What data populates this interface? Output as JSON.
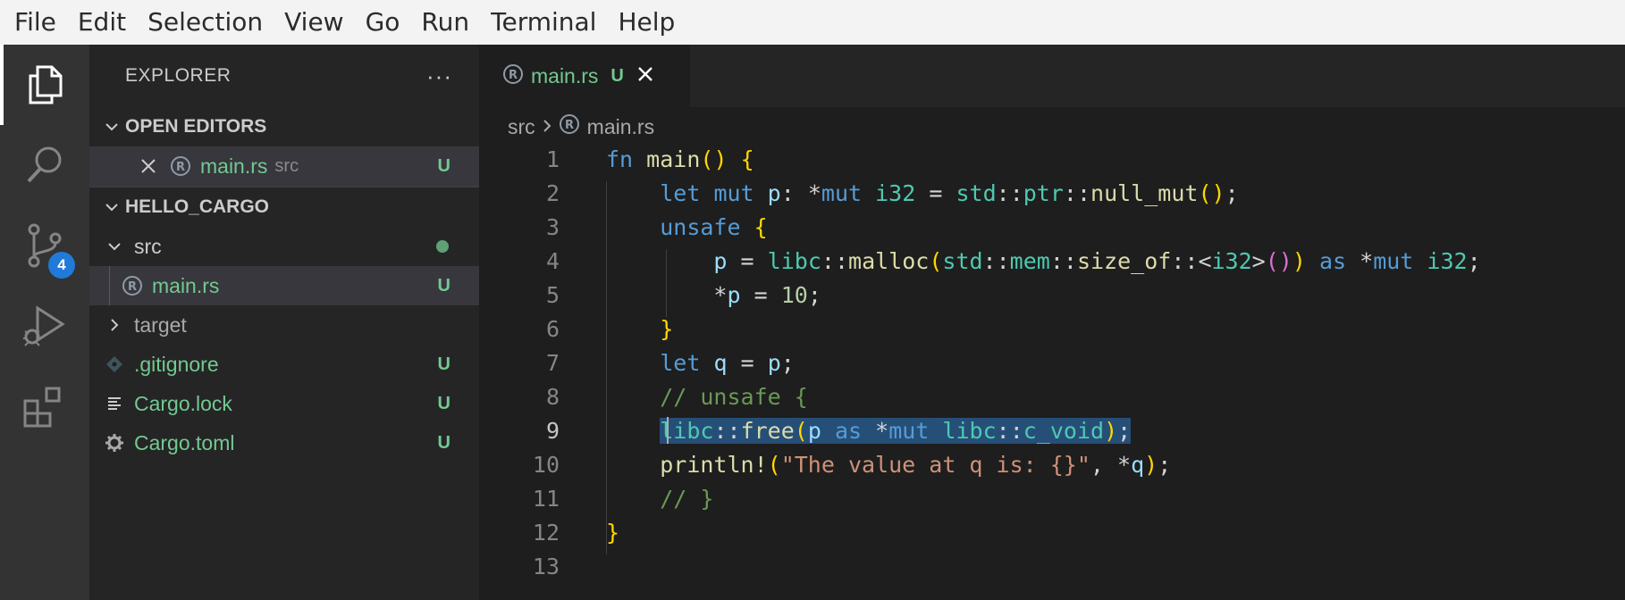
{
  "menu": [
    "File",
    "Edit",
    "Selection",
    "View",
    "Go",
    "Run",
    "Terminal",
    "Help"
  ],
  "activity": {
    "items": [
      "explorer-icon",
      "search-icon",
      "source-control-icon",
      "run-debug-icon",
      "extensions-icon"
    ],
    "scm_badge": "4"
  },
  "sidebar": {
    "title": "EXPLORER",
    "more": "···",
    "open_editors": {
      "header": "OPEN EDITORS",
      "items": [
        {
          "name": "main.rs",
          "desc": "src",
          "status": "U"
        }
      ]
    },
    "project": {
      "header": "HELLO_CARGO",
      "tree": [
        {
          "name": "src",
          "kind": "folder-open",
          "status": "•"
        },
        {
          "name": "main.rs",
          "kind": "rust-file",
          "status": "U"
        },
        {
          "name": "target",
          "kind": "folder-closed",
          "status": ""
        },
        {
          "name": ".gitignore",
          "kind": "git-file",
          "status": "U"
        },
        {
          "name": "Cargo.lock",
          "kind": "lock-file",
          "status": "U"
        },
        {
          "name": "Cargo.toml",
          "kind": "gear-file",
          "status": "U"
        }
      ]
    }
  },
  "editor": {
    "tab": {
      "name": "main.rs",
      "status": "U"
    },
    "breadcrumb": [
      "src",
      "main.rs"
    ],
    "current_line": 9,
    "lines": [
      "fn main() {",
      "    let mut p: *mut i32 = std::ptr::null_mut();",
      "    unsafe {",
      "        p = libc::malloc(std::mem::size_of::<i32>()) as *mut i32;",
      "        *p = 10;",
      "    }",
      "    let q = p;",
      "    // unsafe {",
      "    libc::free(p as *mut libc::c_void);",
      "    println!(\"The value at q is: {}\", *q);",
      "    // }",
      "}",
      ""
    ]
  },
  "colors": {
    "git_untracked": "#73c991",
    "selection": "#264f78",
    "badge": "#1f7ad9"
  }
}
